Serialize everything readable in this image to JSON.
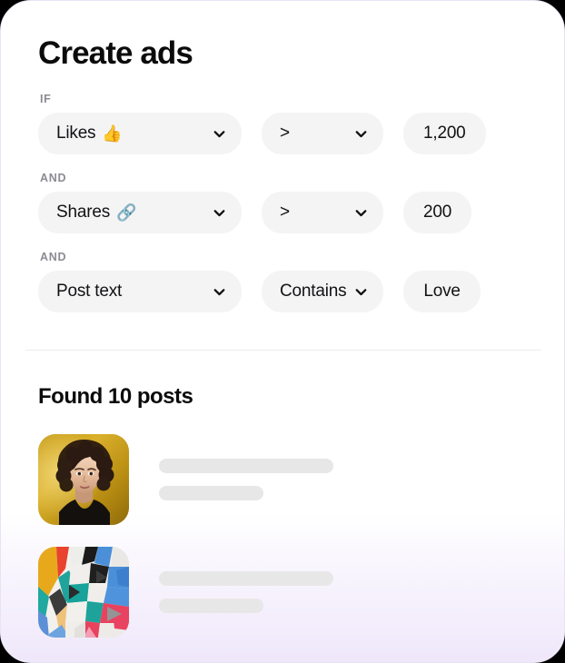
{
  "card": {
    "title": "Create ads",
    "accent_lavender": "#EFE6FA",
    "pill_bg": "#F4F4F5",
    "text_color": "#121214",
    "muted_color": "#8B8B93"
  },
  "rules": [
    {
      "label": "IF",
      "field": "Likes",
      "field_emoji": "👍",
      "operator": ">",
      "value": "1,200"
    },
    {
      "label": "AND",
      "field": "Shares",
      "field_emoji": "🔗",
      "operator": ">",
      "value": "200"
    },
    {
      "label": "AND",
      "field": "Post text",
      "field_emoji": "",
      "operator": "Contains",
      "value": "Love"
    }
  ],
  "results": {
    "heading": "Found 10 posts",
    "posts": [
      {
        "thumbnail": "portrait-woman-gold-background"
      },
      {
        "thumbnail": "abstract-geometric-collage"
      }
    ]
  }
}
